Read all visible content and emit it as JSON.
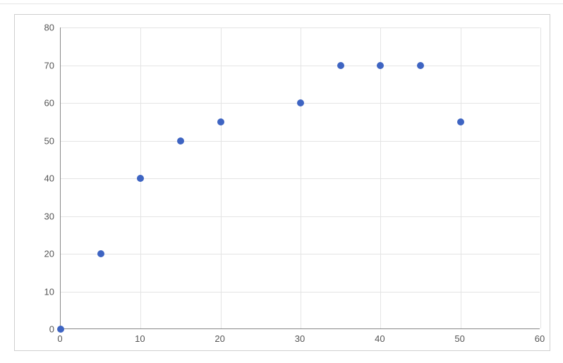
{
  "chart_data": {
    "type": "scatter",
    "x": [
      0,
      5,
      10,
      15,
      20,
      30,
      35,
      40,
      45,
      50
    ],
    "y": [
      0,
      20,
      40,
      50,
      55,
      60,
      70,
      70,
      70,
      55
    ],
    "xlim": [
      0,
      60
    ],
    "ylim": [
      0,
      80
    ],
    "x_ticks": [
      0,
      10,
      20,
      30,
      40,
      50,
      60
    ],
    "y_ticks": [
      0,
      10,
      20,
      30,
      40,
      50,
      60,
      70,
      80
    ],
    "title": "",
    "xlabel": "",
    "ylabel": ""
  },
  "point_color": "#3e64c2"
}
